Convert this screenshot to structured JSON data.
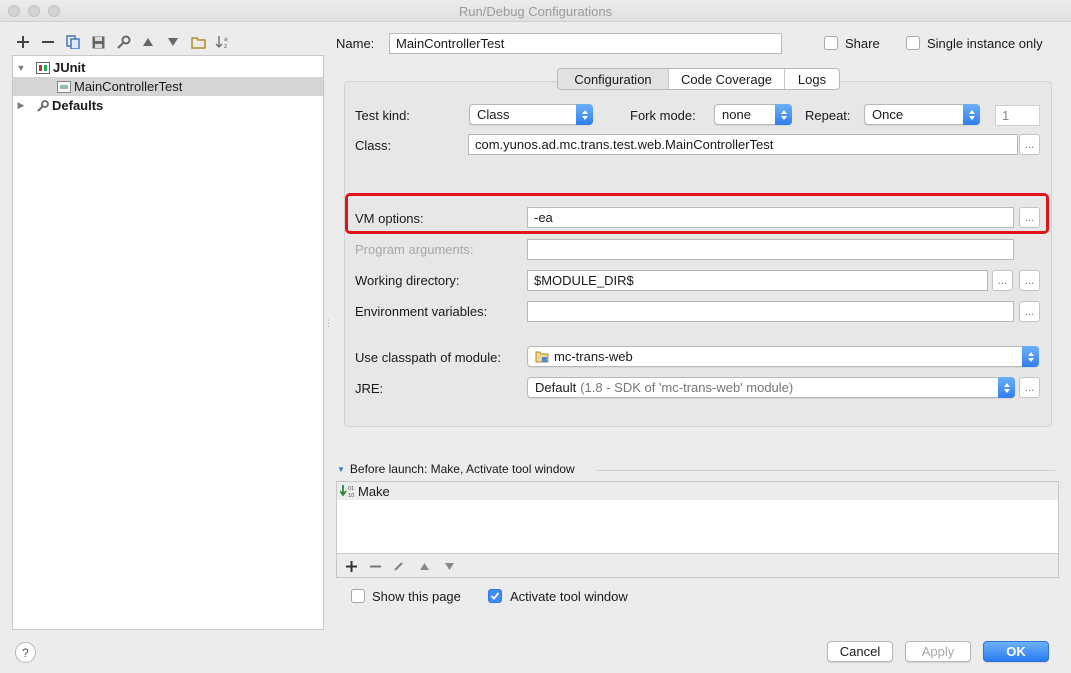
{
  "window": {
    "title": "Run/Debug Configurations"
  },
  "tree": {
    "items": [
      {
        "label": "JUnit"
      },
      {
        "label": "MainControllerTest"
      },
      {
        "label": "Defaults"
      }
    ]
  },
  "header": {
    "name_label": "Name:",
    "name_value": "MainControllerTest",
    "share_label": "Share",
    "single_instance_label": "Single instance only"
  },
  "tabs": [
    "Configuration",
    "Code Coverage",
    "Logs"
  ],
  "config": {
    "test_kind_label": "Test kind:",
    "test_kind_value": "Class",
    "fork_mode_label": "Fork mode:",
    "fork_mode_value": "none",
    "repeat_label": "Repeat:",
    "repeat_value": "Once",
    "repeat_count": "1",
    "class_label": "Class:",
    "class_value": "com.yunos.ad.mc.trans.test.web.MainControllerTest",
    "vm_options_label": "VM options:",
    "vm_options_value": "-ea",
    "program_args_label": "Program arguments:",
    "program_args_value": "",
    "working_dir_label": "Working directory:",
    "working_dir_value": "$MODULE_DIR$",
    "env_vars_label": "Environment variables:",
    "env_vars_value": "",
    "classpath_label": "Use classpath of module:",
    "classpath_value": "mc-trans-web",
    "jre_label": "JRE:",
    "jre_value": "Default",
    "jre_detail": "(1.8 - SDK of 'mc-trans-web' module)",
    "ellipsis": "..."
  },
  "before_launch": {
    "title": "Before launch: Make, Activate tool window",
    "items": [
      "Make"
    ],
    "show_page_label": "Show this page",
    "activate_tool_label": "Activate tool window"
  },
  "buttons": {
    "help": "?",
    "cancel": "Cancel",
    "apply": "Apply",
    "ok": "OK"
  },
  "colors": {
    "accent": "#2f7ef0",
    "highlight": "#e0151b"
  }
}
